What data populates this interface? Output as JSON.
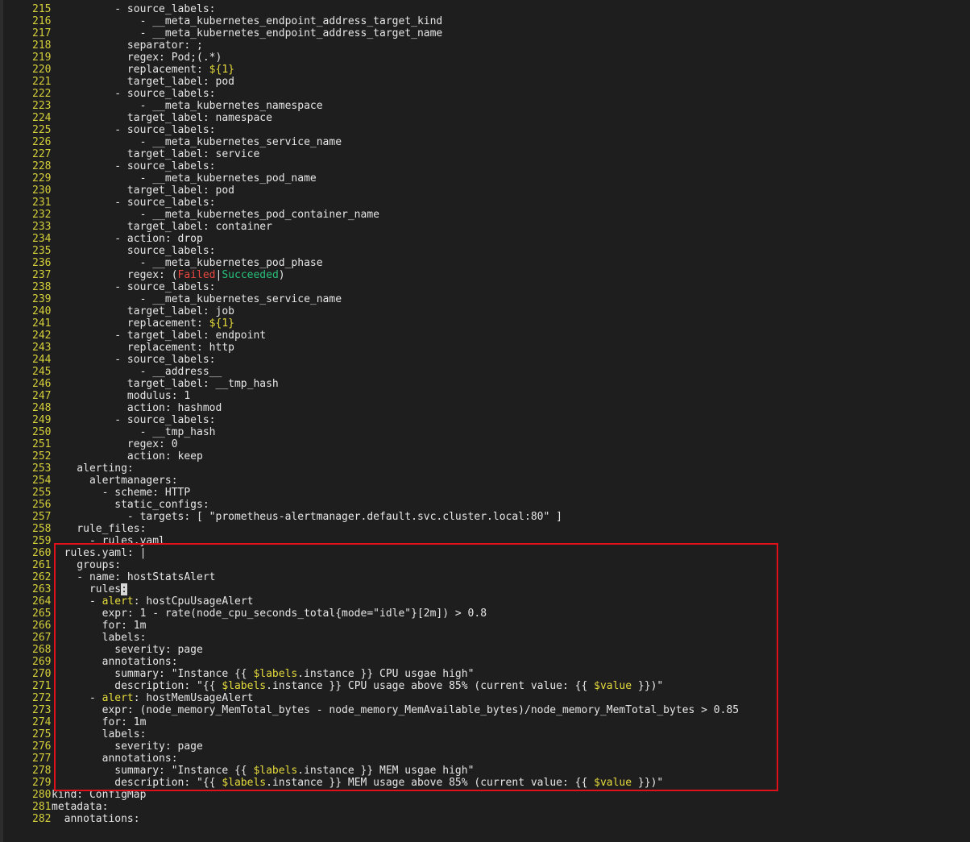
{
  "editor": {
    "lines": [
      {
        "n": "215",
        "segs": [
          {
            "t": "s",
            "v": "          - source_labels:"
          }
        ]
      },
      {
        "n": "216",
        "segs": [
          {
            "t": "s",
            "v": "              - __meta_kubernetes_endpoint_address_target_kind"
          }
        ]
      },
      {
        "n": "217",
        "segs": [
          {
            "t": "s",
            "v": "              - __meta_kubernetes_endpoint_address_target_name"
          }
        ]
      },
      {
        "n": "218",
        "segs": [
          {
            "t": "s",
            "v": "            separator: ;"
          }
        ]
      },
      {
        "n": "219",
        "segs": [
          {
            "t": "s",
            "v": "            regex: Pod;(.*)"
          }
        ]
      },
      {
        "n": "220",
        "segs": [
          {
            "t": "s",
            "v": "            replacement: "
          },
          {
            "t": "y",
            "v": "${1}"
          }
        ]
      },
      {
        "n": "221",
        "segs": [
          {
            "t": "s",
            "v": "            target_label: pod"
          }
        ]
      },
      {
        "n": "222",
        "segs": [
          {
            "t": "s",
            "v": "          - source_labels:"
          }
        ]
      },
      {
        "n": "223",
        "segs": [
          {
            "t": "s",
            "v": "              - __meta_kubernetes_namespace"
          }
        ]
      },
      {
        "n": "224",
        "segs": [
          {
            "t": "s",
            "v": "            target_label: namespace"
          }
        ]
      },
      {
        "n": "225",
        "segs": [
          {
            "t": "s",
            "v": "          - source_labels:"
          }
        ]
      },
      {
        "n": "226",
        "segs": [
          {
            "t": "s",
            "v": "              - __meta_kubernetes_service_name"
          }
        ]
      },
      {
        "n": "227",
        "segs": [
          {
            "t": "s",
            "v": "            target_label: service"
          }
        ]
      },
      {
        "n": "228",
        "segs": [
          {
            "t": "s",
            "v": "          - source_labels:"
          }
        ]
      },
      {
        "n": "229",
        "segs": [
          {
            "t": "s",
            "v": "              - __meta_kubernetes_pod_name"
          }
        ]
      },
      {
        "n": "230",
        "segs": [
          {
            "t": "s",
            "v": "            target_label: pod"
          }
        ]
      },
      {
        "n": "231",
        "segs": [
          {
            "t": "s",
            "v": "          - source_labels:"
          }
        ]
      },
      {
        "n": "232",
        "segs": [
          {
            "t": "s",
            "v": "              - __meta_kubernetes_pod_container_name"
          }
        ]
      },
      {
        "n": "233",
        "segs": [
          {
            "t": "s",
            "v": "            target_label: container"
          }
        ]
      },
      {
        "n": "234",
        "segs": [
          {
            "t": "s",
            "v": "          - action: drop"
          }
        ]
      },
      {
        "n": "235",
        "segs": [
          {
            "t": "s",
            "v": "            source_labels:"
          }
        ]
      },
      {
        "n": "236",
        "segs": [
          {
            "t": "s",
            "v": "              - __meta_kubernetes_pod_phase"
          }
        ]
      },
      {
        "n": "237",
        "segs": [
          {
            "t": "s",
            "v": "            regex: ("
          },
          {
            "t": "r",
            "v": "Failed"
          },
          {
            "t": "s",
            "v": "|"
          },
          {
            "t": "g",
            "v": "Succeeded"
          },
          {
            "t": "s",
            "v": ")"
          }
        ]
      },
      {
        "n": "238",
        "segs": [
          {
            "t": "s",
            "v": "          - source_labels:"
          }
        ]
      },
      {
        "n": "239",
        "segs": [
          {
            "t": "s",
            "v": "              - __meta_kubernetes_service_name"
          }
        ]
      },
      {
        "n": "240",
        "segs": [
          {
            "t": "s",
            "v": "            target_label: job"
          }
        ]
      },
      {
        "n": "241",
        "segs": [
          {
            "t": "s",
            "v": "            replacement: "
          },
          {
            "t": "y",
            "v": "${1}"
          }
        ]
      },
      {
        "n": "242",
        "segs": [
          {
            "t": "s",
            "v": "          - target_label: endpoint"
          }
        ]
      },
      {
        "n": "243",
        "segs": [
          {
            "t": "s",
            "v": "            replacement: http"
          }
        ]
      },
      {
        "n": "244",
        "segs": [
          {
            "t": "s",
            "v": "          - source_labels:"
          }
        ]
      },
      {
        "n": "245",
        "segs": [
          {
            "t": "s",
            "v": "              - __address__"
          }
        ]
      },
      {
        "n": "246",
        "segs": [
          {
            "t": "s",
            "v": "            target_label: __tmp_hash"
          }
        ]
      },
      {
        "n": "247",
        "segs": [
          {
            "t": "s",
            "v": "            modulus: 1"
          }
        ]
      },
      {
        "n": "248",
        "segs": [
          {
            "t": "s",
            "v": "            action: hashmod"
          }
        ]
      },
      {
        "n": "249",
        "segs": [
          {
            "t": "s",
            "v": "          - source_labels:"
          }
        ]
      },
      {
        "n": "250",
        "segs": [
          {
            "t": "s",
            "v": "              - __tmp_hash"
          }
        ]
      },
      {
        "n": "251",
        "segs": [
          {
            "t": "s",
            "v": "            regex: 0"
          }
        ]
      },
      {
        "n": "252",
        "segs": [
          {
            "t": "s",
            "v": "            action: keep"
          }
        ]
      },
      {
        "n": "253",
        "segs": [
          {
            "t": "s",
            "v": "    alerting:"
          }
        ]
      },
      {
        "n": "254",
        "segs": [
          {
            "t": "s",
            "v": "      alertmanagers:"
          }
        ]
      },
      {
        "n": "255",
        "segs": [
          {
            "t": "s",
            "v": "        - scheme: HTTP"
          }
        ]
      },
      {
        "n": "256",
        "segs": [
          {
            "t": "s",
            "v": "          static_configs:"
          }
        ]
      },
      {
        "n": "257",
        "segs": [
          {
            "t": "s",
            "v": "            - targets: [ \"prometheus-alertmanager.default.svc.cluster.local:80\" ]"
          }
        ]
      },
      {
        "n": "258",
        "segs": [
          {
            "t": "s",
            "v": "    rule_files:"
          }
        ]
      },
      {
        "n": "259",
        "segs": [
          {
            "t": "s",
            "v": "      - rules.yaml"
          }
        ]
      },
      {
        "n": "260",
        "segs": [
          {
            "t": "s",
            "v": "  rules.yaml: |"
          }
        ]
      },
      {
        "n": "261",
        "segs": [
          {
            "t": "s",
            "v": "    groups:"
          }
        ]
      },
      {
        "n": "262",
        "segs": [
          {
            "t": "s",
            "v": "    - name: hostStatsAlert"
          }
        ]
      },
      {
        "n": "263",
        "segs": [
          {
            "t": "s",
            "v": "      rules"
          },
          {
            "t": "c",
            "v": ":"
          }
        ]
      },
      {
        "n": "264",
        "segs": [
          {
            "t": "s",
            "v": "      - "
          },
          {
            "t": "y",
            "v": "alert"
          },
          {
            "t": "s",
            "v": ": hostCpuUsageAlert"
          }
        ]
      },
      {
        "n": "265",
        "segs": [
          {
            "t": "s",
            "v": "        expr: 1 - rate(node_cpu_seconds_total{mode=\"idle\"}[2m]) > 0.8"
          }
        ]
      },
      {
        "n": "266",
        "segs": [
          {
            "t": "s",
            "v": "        for: 1m"
          }
        ]
      },
      {
        "n": "267",
        "segs": [
          {
            "t": "s",
            "v": "        labels:"
          }
        ]
      },
      {
        "n": "268",
        "segs": [
          {
            "t": "s",
            "v": "          severity: page"
          }
        ]
      },
      {
        "n": "269",
        "segs": [
          {
            "t": "s",
            "v": "        annotations:"
          }
        ]
      },
      {
        "n": "270",
        "segs": [
          {
            "t": "s",
            "v": "          summary: \"Instance {{ "
          },
          {
            "t": "y",
            "v": "$labels"
          },
          {
            "t": "s",
            "v": ".instance }} CPU usgae high\""
          }
        ]
      },
      {
        "n": "271",
        "segs": [
          {
            "t": "s",
            "v": "          description: \"{{ "
          },
          {
            "t": "y",
            "v": "$labels"
          },
          {
            "t": "s",
            "v": ".instance }} CPU usage above 85% (current value: {{ "
          },
          {
            "t": "y",
            "v": "$value"
          },
          {
            "t": "s",
            "v": " }})\""
          }
        ]
      },
      {
        "n": "272",
        "segs": [
          {
            "t": "s",
            "v": "      - "
          },
          {
            "t": "y",
            "v": "alert"
          },
          {
            "t": "s",
            "v": ": hostMemUsageAlert"
          }
        ]
      },
      {
        "n": "273",
        "segs": [
          {
            "t": "s",
            "v": "        expr: (node_memory_MemTotal_bytes - node_memory_MemAvailable_bytes)/node_memory_MemTotal_bytes > 0.85"
          }
        ]
      },
      {
        "n": "274",
        "segs": [
          {
            "t": "s",
            "v": "        for: 1m"
          }
        ]
      },
      {
        "n": "275",
        "segs": [
          {
            "t": "s",
            "v": "        labels:"
          }
        ]
      },
      {
        "n": "276",
        "segs": [
          {
            "t": "s",
            "v": "          severity: page"
          }
        ]
      },
      {
        "n": "277",
        "segs": [
          {
            "t": "s",
            "v": "        annotations:"
          }
        ]
      },
      {
        "n": "278",
        "segs": [
          {
            "t": "s",
            "v": "          summary: \"Instance {{ "
          },
          {
            "t": "y",
            "v": "$labels"
          },
          {
            "t": "s",
            "v": ".instance }} MEM usgae high\""
          }
        ]
      },
      {
        "n": "279",
        "segs": [
          {
            "t": "s",
            "v": "          description: \"{{ "
          },
          {
            "t": "y",
            "v": "$labels"
          },
          {
            "t": "s",
            "v": ".instance }} MEM usage above 85% (current value: {{ "
          },
          {
            "t": "y",
            "v": "$value"
          },
          {
            "t": "s",
            "v": " }})\""
          }
        ]
      },
      {
        "n": "280",
        "segs": [
          {
            "t": "s",
            "v": "kind: ConfigMap"
          }
        ]
      },
      {
        "n": "281",
        "segs": [
          {
            "t": "s",
            "v": "metadata:"
          }
        ]
      },
      {
        "n": "282",
        "segs": [
          {
            "t": "s",
            "v": "  annotations:"
          }
        ]
      }
    ]
  },
  "colors": {
    "background": "#1e1e1e",
    "line_number": "#d4cf3a",
    "text": "#e6e6e6",
    "keyword_yellow": "#e6db3c",
    "failed_red": "#e8463f",
    "succeeded_green": "#27c079",
    "highlight_border": "#e0101a"
  }
}
